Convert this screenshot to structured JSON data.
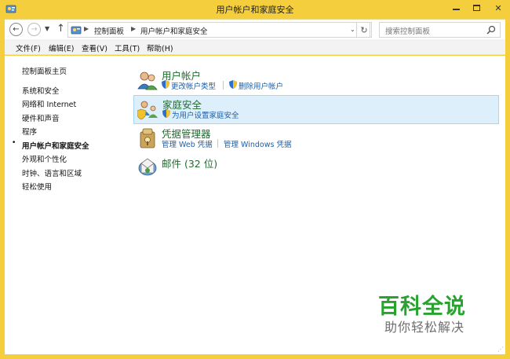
{
  "window": {
    "title": "用户帐户和家庭安全",
    "accent_color": "#f4ce3c",
    "icon": "control-panel-icon"
  },
  "caption": {
    "minimize_icon": "minimize-icon",
    "maximize_icon": "maximize-icon",
    "close_label": "✕"
  },
  "address_bar": {
    "back_glyph": "←",
    "forward_glyph": "→",
    "dropdown_glyph": "▼",
    "up_glyph": "↑",
    "breadcrumbs": [
      "控制面板",
      "用户帐户和家庭安全"
    ],
    "separator": "▶",
    "addr_dropdown_glyph": "⌄",
    "refresh_glyph": "↻",
    "search_placeholder": "搜索控制面板"
  },
  "menu": {
    "items": [
      "文件(F)",
      "编辑(E)",
      "查看(V)",
      "工具(T)",
      "帮助(H)"
    ]
  },
  "sidebar": {
    "home": "控制面板主页",
    "items": [
      {
        "label": "系统和安全",
        "active": false
      },
      {
        "label": "网络和 Internet",
        "active": false
      },
      {
        "label": "硬件和声音",
        "active": false
      },
      {
        "label": "程序",
        "active": false
      },
      {
        "label": "用户帐户和家庭安全",
        "active": true
      },
      {
        "label": "外观和个性化",
        "active": false
      },
      {
        "label": "时钟、语言和区域",
        "active": false
      },
      {
        "label": "轻松使用",
        "active": false
      }
    ],
    "bullet": "•"
  },
  "categories": [
    {
      "title": "用户帐户",
      "icon": "user-accounts-icon",
      "links": [
        "更改帐户类型",
        "删除用户帐户"
      ]
    },
    {
      "title": "家庭安全",
      "icon": "family-safety-icon",
      "selected": true,
      "links": [
        "为用户设置家庭安全"
      ]
    },
    {
      "title": "凭据管理器",
      "icon": "credential-manager-icon",
      "links": [
        "管理 Web 凭据",
        "管理 Windows 凭据"
      ]
    },
    {
      "title": "邮件 (32 位)",
      "icon": "mail-icon",
      "links": []
    }
  ],
  "watermark": {
    "main": "百科全说",
    "sub": "助你轻松解决"
  }
}
